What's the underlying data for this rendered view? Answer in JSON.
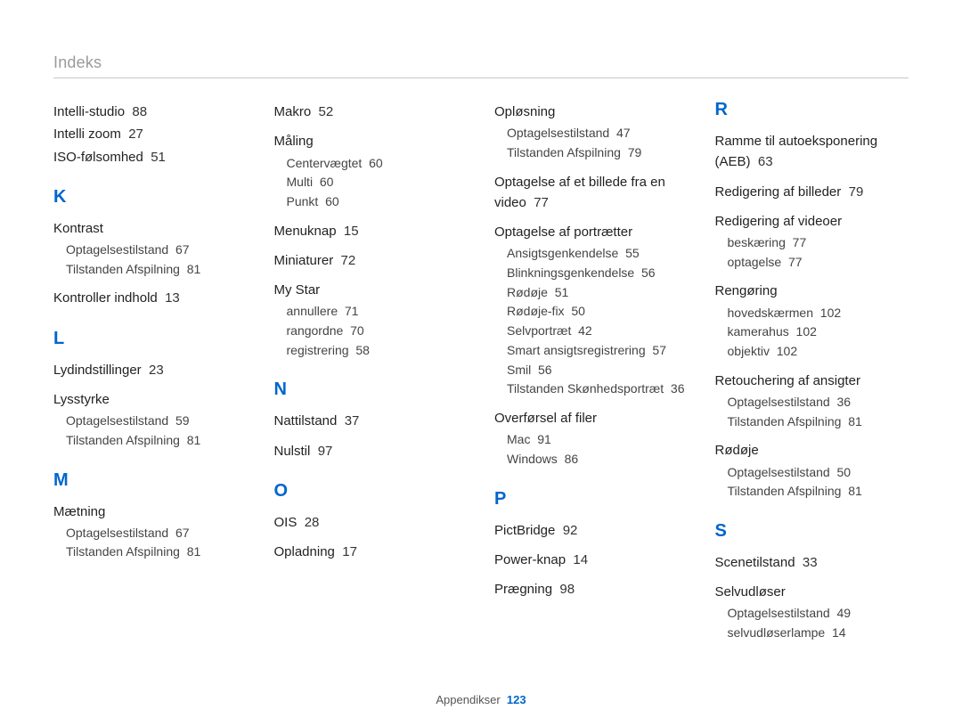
{
  "header": "Indeks",
  "footer": {
    "label": "Appendikser",
    "page": "123"
  },
  "col1": {
    "entries_top": [
      {
        "t": "Intelli-studio",
        "p": "88"
      },
      {
        "t": "Intelli zoom",
        "p": "27"
      },
      {
        "t": "ISO-følsomhed",
        "p": "51"
      }
    ],
    "K": {
      "letter": "K",
      "kontrast": {
        "t": "Kontrast",
        "subs": [
          {
            "t": "Optagelsestilstand",
            "p": "67"
          },
          {
            "t": "Tilstanden Afspilning",
            "p": "81"
          }
        ]
      },
      "kontroller": {
        "t": "Kontroller indhold",
        "p": "13"
      }
    },
    "L": {
      "letter": "L",
      "lyd": {
        "t": "Lydindstillinger",
        "p": "23"
      },
      "lysstyrke": {
        "t": "Lysstyrke",
        "subs": [
          {
            "t": "Optagelsestilstand",
            "p": "59"
          },
          {
            "t": "Tilstanden Afspilning",
            "p": "81"
          }
        ]
      }
    },
    "M": {
      "letter": "M",
      "maetning": {
        "t": "Mætning",
        "subs": [
          {
            "t": "Optagelsestilstand",
            "p": "67"
          },
          {
            "t": "Tilstanden Afspilning",
            "p": "81"
          }
        ]
      }
    }
  },
  "col2": {
    "Mtop": {
      "makro": {
        "t": "Makro",
        "p": "52"
      },
      "maaling": {
        "t": "Måling",
        "subs": [
          {
            "t": "Centervægtet",
            "p": "60"
          },
          {
            "t": "Multi",
            "p": "60"
          },
          {
            "t": "Punkt",
            "p": "60"
          }
        ]
      },
      "menuknap": {
        "t": "Menuknap",
        "p": "15"
      },
      "miniaturer": {
        "t": "Miniaturer",
        "p": "72"
      },
      "mystar": {
        "t": "My Star",
        "subs": [
          {
            "t": "annullere",
            "p": "71"
          },
          {
            "t": "rangordne",
            "p": "70"
          },
          {
            "t": "registrering",
            "p": "58"
          }
        ]
      }
    },
    "N": {
      "letter": "N",
      "nattilstand": {
        "t": "Nattilstand",
        "p": "37"
      },
      "nulstil": {
        "t": "Nulstil",
        "p": "97"
      }
    },
    "O": {
      "letter": "O",
      "ois": {
        "t": "OIS",
        "p": "28"
      },
      "opladning": {
        "t": "Opladning",
        "p": "17"
      }
    }
  },
  "col3": {
    "Otop": {
      "oploesning": {
        "t": "Opløsning",
        "subs": [
          {
            "t": "Optagelsestilstand",
            "p": "47"
          },
          {
            "t": "Tilstanden Afspilning",
            "p": "79"
          }
        ]
      },
      "optagelsevideobillede": {
        "t": "Optagelse af et billede fra en video",
        "p": "77"
      },
      "portraet": {
        "t": "Optagelse af portrætter",
        "subs": [
          {
            "t": "Ansigtsgenkendelse",
            "p": "55"
          },
          {
            "t": "Blinkningsgenkendelse",
            "p": "56"
          },
          {
            "t": "Rødøje",
            "p": "51"
          },
          {
            "t": "Rødøje-fix",
            "p": "50"
          },
          {
            "t": "Selvportræt",
            "p": "42"
          },
          {
            "t": "Smart ansigtsregistrering",
            "p": "57"
          },
          {
            "t": "Smil",
            "p": "56"
          },
          {
            "t": "Tilstanden Skønhedsportræt",
            "p": "36"
          }
        ]
      },
      "filer": {
        "t": "Overførsel af filer",
        "subs": [
          {
            "t": "Mac",
            "p": "91"
          },
          {
            "t": "Windows",
            "p": "86"
          }
        ]
      }
    },
    "P": {
      "letter": "P",
      "pictbridge": {
        "t": "PictBridge",
        "p": "92"
      },
      "power": {
        "t": "Power-knap",
        "p": "14"
      },
      "praegning": {
        "t": "Prægning",
        "p": "98"
      }
    }
  },
  "col4": {
    "R": {
      "letter": "R",
      "ramme": {
        "t": "Ramme til autoeksponering (AEB)",
        "p": "63"
      },
      "redigbil": {
        "t": "Redigering af billeder",
        "p": "79"
      },
      "redigvid": {
        "t": "Redigering af videoer",
        "subs": [
          {
            "t": "beskæring",
            "p": "77"
          },
          {
            "t": "optagelse",
            "p": "77"
          }
        ]
      },
      "rengoring": {
        "t": "Rengøring",
        "subs": [
          {
            "t": "hovedskærmen",
            "p": "102"
          },
          {
            "t": "kamerahus",
            "p": "102"
          },
          {
            "t": "objektiv",
            "p": "102"
          }
        ]
      },
      "retouch": {
        "t": "Retouchering af ansigter",
        "subs": [
          {
            "t": "Optagelsestilstand",
            "p": "36"
          },
          {
            "t": "Tilstanden Afspilning",
            "p": "81"
          }
        ]
      },
      "rodoje": {
        "t": "Rødøje",
        "subs": [
          {
            "t": "Optagelsestilstand",
            "p": "50"
          },
          {
            "t": "Tilstanden Afspilning",
            "p": "81"
          }
        ]
      }
    },
    "S": {
      "letter": "S",
      "scene": {
        "t": "Scenetilstand",
        "p": "33"
      },
      "selvud": {
        "t": "Selvudløser",
        "subs": [
          {
            "t": "Optagelsestilstand",
            "p": "49"
          },
          {
            "t": "selvudløserlampe",
            "p": "14"
          }
        ]
      }
    }
  }
}
